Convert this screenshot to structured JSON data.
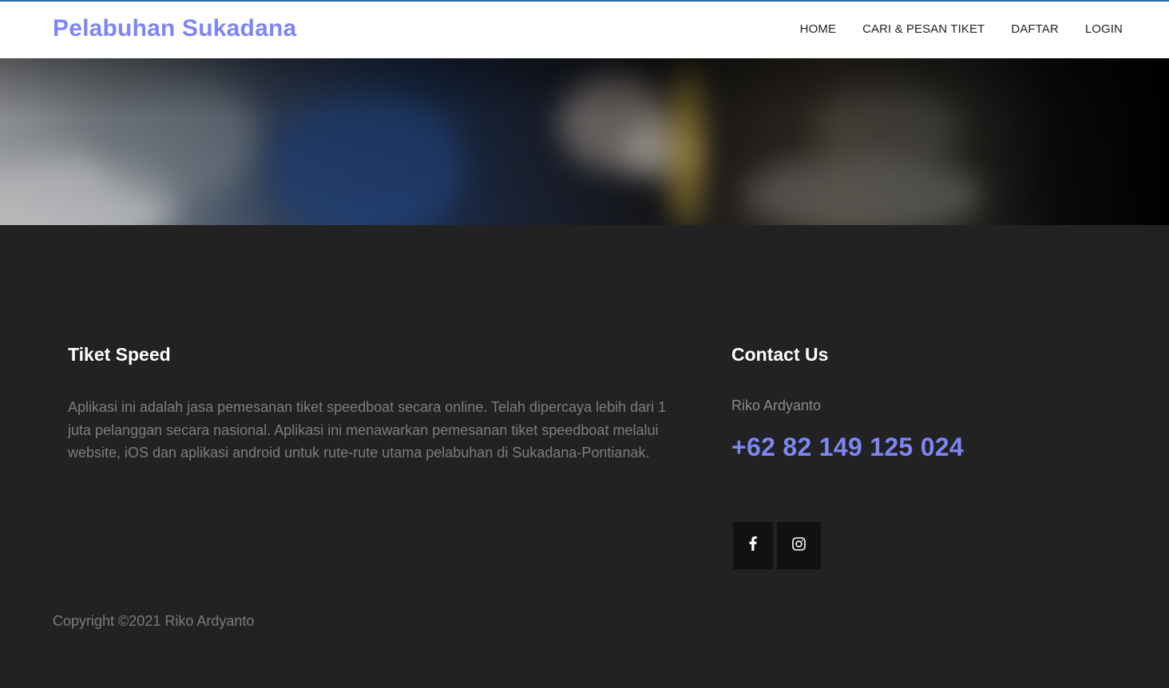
{
  "header": {
    "brand": "Pelabuhan Sukadana",
    "nav": [
      {
        "label": "HOME"
      },
      {
        "label": "CARI & PESAN TIKET"
      },
      {
        "label": "DAFTAR"
      },
      {
        "label": "LOGIN"
      }
    ]
  },
  "footer": {
    "about": {
      "title": "Tiket Speed",
      "text": "Aplikasi ini adalah jasa pemesanan tiket speedboat secara online. Telah dipercaya lebih dari 1 juta pelanggan secara nasional. Aplikasi ini menawarkan pemesanan tiket speedboat melalui website, iOS dan aplikasi android untuk rute-rute utama pelabuhan di Sukadana-Pontianak."
    },
    "contact": {
      "title": "Contact Us",
      "name": "Riko Ardyanto",
      "phone": "+62 82 149 125 024"
    },
    "social": [
      {
        "icon": "facebook-icon"
      },
      {
        "icon": "instagram-icon"
      }
    ],
    "copyright": "Copyright ©2021 Riko Ardyanto"
  },
  "colors": {
    "brand": "#7d86f3",
    "footer_bg": "#222222",
    "header_bg": "#ffffff"
  }
}
